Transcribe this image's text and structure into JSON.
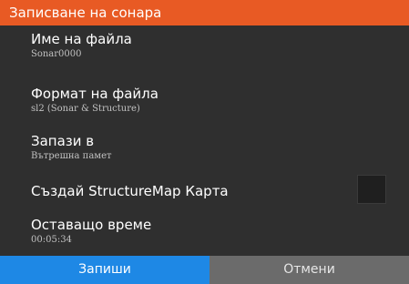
{
  "dialog": {
    "title": "Записване на сонара",
    "accent_color": "#e85a24",
    "fields": {
      "filename": {
        "label": "Име на файла",
        "value": "Sonar0000"
      },
      "format": {
        "label": "Формат на файла",
        "value": "sl2 (Sonar & Structure)"
      },
      "save_in": {
        "label": "Запази в",
        "value": "Вътрешна памет"
      },
      "structuremap": {
        "label": "Създай StructureMap Карта",
        "checked": false
      },
      "remaining": {
        "label": "Оставащо време",
        "value": "00:05:34"
      }
    },
    "buttons": {
      "save_label": "Запиши",
      "save_color": "#1e88e5",
      "cancel_label": "Отмени",
      "cancel_color": "#6b6b6b"
    }
  }
}
